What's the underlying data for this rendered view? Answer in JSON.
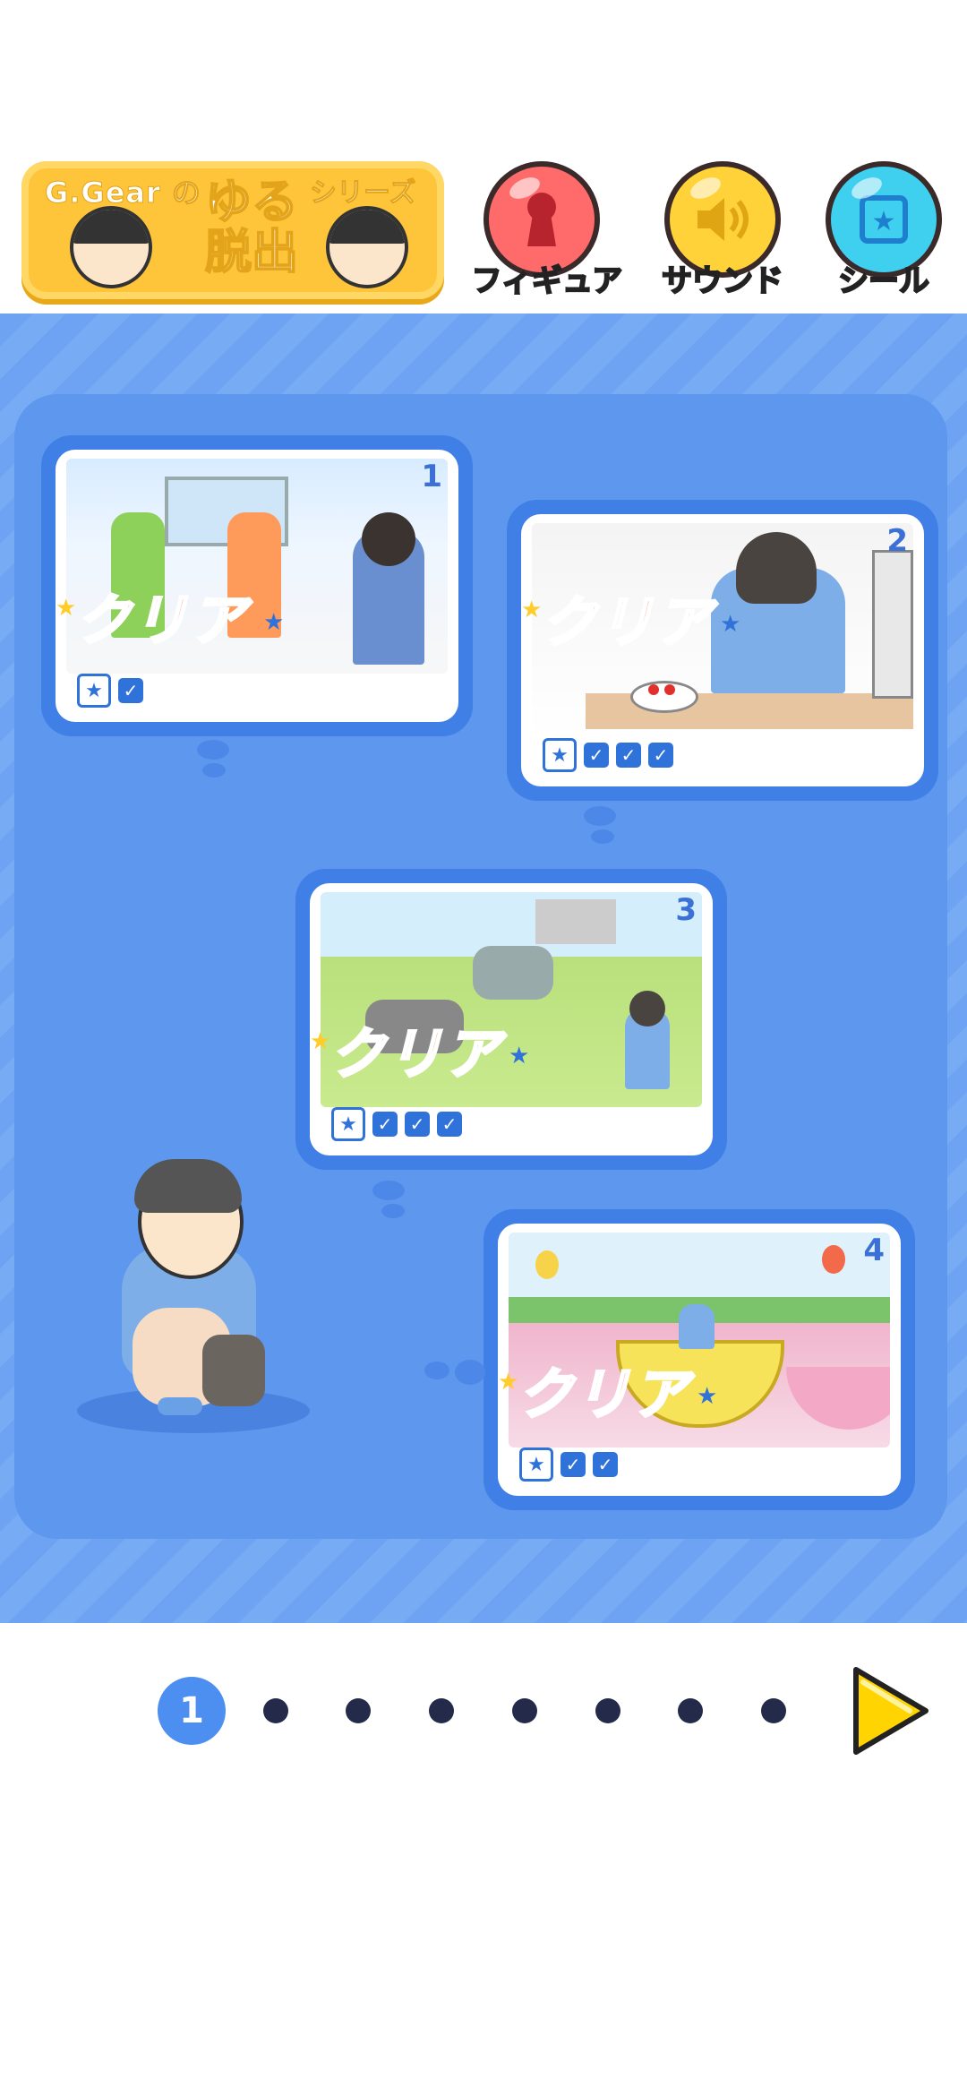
{
  "header": {
    "logo": {
      "brand": "G.Gear の",
      "title_line1": "ゆる",
      "title_line2": "脱出",
      "series": "シリーズ"
    },
    "buttons": [
      {
        "label": "フィギュア",
        "icon": "keyhole-icon",
        "color": "#ff6b6b"
      },
      {
        "label": "サウンド",
        "icon": "speaker-icon",
        "color": "#ffd23a"
      },
      {
        "label": "シール",
        "icon": "sticker-icon",
        "color": "#3fd0f0"
      }
    ]
  },
  "stages": [
    {
      "number": "1",
      "status": "クリア",
      "checks": 1
    },
    {
      "number": "2",
      "status": "クリア",
      "checks": 3
    },
    {
      "number": "3",
      "status": "クリア",
      "checks": 3
    },
    {
      "number": "4",
      "status": "クリア",
      "checks": 2
    }
  ],
  "pager": {
    "current": "1",
    "total_pages": 8
  },
  "colors": {
    "board": "#6da3f2",
    "card": "#3f7fe6",
    "clear_text": "#ff5a37",
    "next": "#ffd400"
  }
}
